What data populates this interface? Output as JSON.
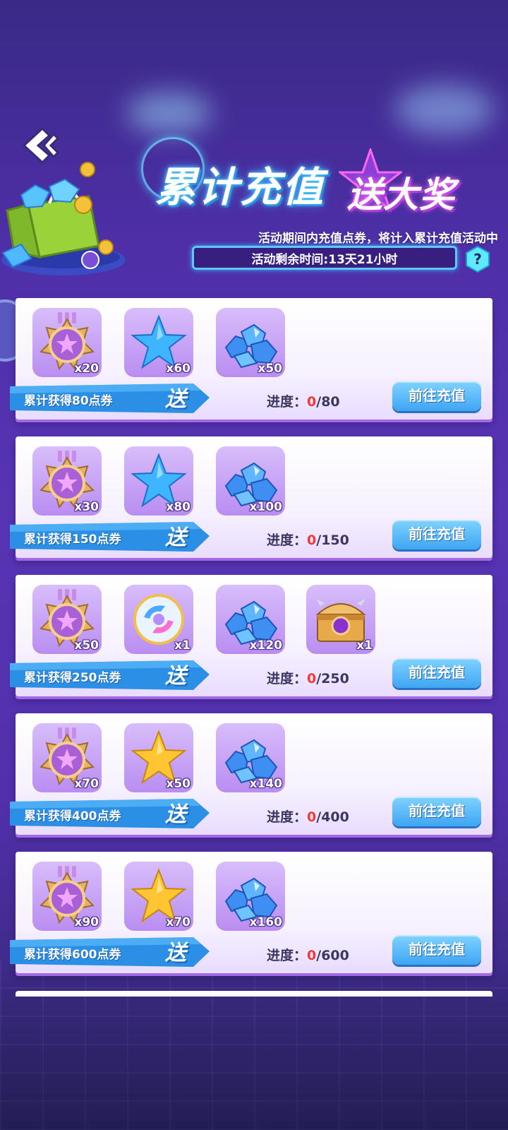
{
  "header": {
    "title_main": "累计充值",
    "title_sub": "送大奖",
    "description": "活动期间内充值点券，将计入累计充值活动中",
    "timer_text": "活动剩余时间:13天21小时",
    "help_label": "?"
  },
  "tiers": [
    {
      "label": "累计获得80点券",
      "song": "送",
      "progress_label": "进度：",
      "current": "0",
      "target": "/80",
      "button": "前往充值",
      "rewards": [
        {
          "icon": "star-medal-icon",
          "qty": "x20"
        },
        {
          "icon": "blue-star-icon",
          "qty": "x60"
        },
        {
          "icon": "blue-gems-icon",
          "qty": "x50"
        }
      ]
    },
    {
      "label": "累计获得150点券",
      "song": "送",
      "progress_label": "进度：",
      "current": "0",
      "target": "/150",
      "button": "前往充值",
      "rewards": [
        {
          "icon": "star-medal-icon",
          "qty": "x30"
        },
        {
          "icon": "blue-star-icon",
          "qty": "x80"
        },
        {
          "icon": "blue-gems-icon",
          "qty": "x100"
        }
      ]
    },
    {
      "label": "累计获得250点券",
      "song": "送",
      "progress_label": "进度：",
      "current": "0",
      "target": "/250",
      "button": "前往充值",
      "rewards": [
        {
          "icon": "star-medal-icon",
          "qty": "x50"
        },
        {
          "icon": "swirl-orb-icon",
          "qty": "x1"
        },
        {
          "icon": "blue-gems-icon",
          "qty": "x120"
        },
        {
          "icon": "treasure-chest-icon",
          "qty": "x1"
        }
      ]
    },
    {
      "label": "累计获得400点券",
      "song": "送",
      "progress_label": "进度：",
      "current": "0",
      "target": "/400",
      "button": "前往充值",
      "rewards": [
        {
          "icon": "star-medal-icon",
          "qty": "x70"
        },
        {
          "icon": "gold-star-icon",
          "qty": "x50"
        },
        {
          "icon": "blue-gems-icon",
          "qty": "x140"
        }
      ]
    },
    {
      "label": "累计获得600点券",
      "song": "送",
      "progress_label": "进度：",
      "current": "0",
      "target": "/600",
      "button": "前往充值",
      "rewards": [
        {
          "icon": "star-medal-icon",
          "qty": "x90"
        },
        {
          "icon": "gold-star-icon",
          "qty": "x70"
        },
        {
          "icon": "blue-gems-icon",
          "qty": "x160"
        }
      ]
    }
  ],
  "colors": {
    "accent_blue": "#3fa5f2",
    "progress_current": "#f03a3a",
    "card_border": "#a169e6"
  }
}
